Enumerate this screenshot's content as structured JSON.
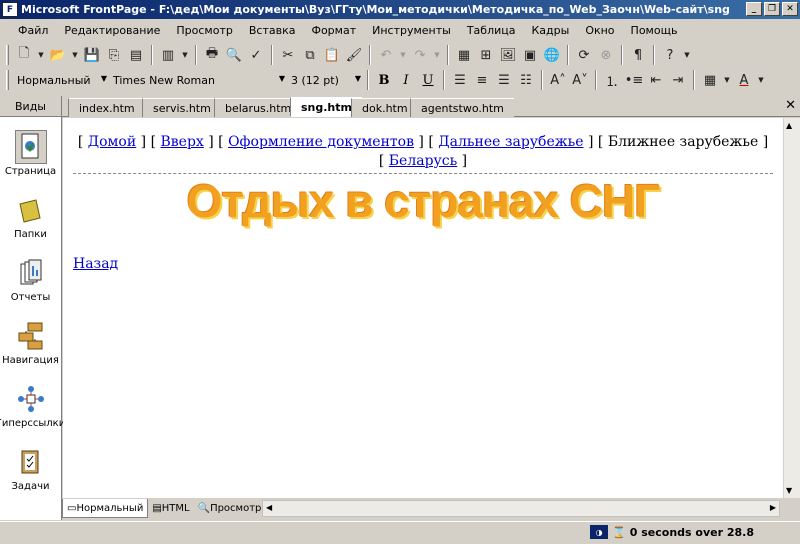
{
  "window": {
    "title": "Microsoft FrontPage - F:\\дед\\Мои документы\\Вуз\\ГГту\\Мои_методички\\Методичка_по_Web_Заочн\\Web-сайт\\sng.h..."
  },
  "menu": [
    "Файл",
    "Редактирование",
    "Просмотр",
    "Вставка",
    "Формат",
    "Инструменты",
    "Таблица",
    "Кадры",
    "Окно",
    "Помощь"
  ],
  "format_toolbar": {
    "style": "Нормальный",
    "font": "Times New Roman",
    "size": "3  (12 pt)",
    "bold": "B",
    "italic": "I",
    "underline": "U"
  },
  "views": {
    "header": "Виды",
    "items": [
      {
        "label": "Страница",
        "icon": "page-view-icon",
        "selected": true
      },
      {
        "label": "Папки",
        "icon": "folders-view-icon",
        "selected": false
      },
      {
        "label": "Отчеты",
        "icon": "reports-view-icon",
        "selected": false
      },
      {
        "label": "Навигация",
        "icon": "navigation-view-icon",
        "selected": false
      },
      {
        "label": "Гиперссылки",
        "icon": "hyperlinks-view-icon",
        "selected": false
      },
      {
        "label": "Задачи",
        "icon": "tasks-view-icon",
        "selected": false
      }
    ]
  },
  "tabs": [
    {
      "label": "index.htm",
      "active": false
    },
    {
      "label": "servis.htm",
      "active": false
    },
    {
      "label": "belarus.htm",
      "active": false
    },
    {
      "label": "sng.htm",
      "active": true
    },
    {
      "label": "dok.htm",
      "active": false
    },
    {
      "label": "agentstwo.htm",
      "active": false
    }
  ],
  "page": {
    "nav": {
      "home": "Домой",
      "up": "Вверх",
      "docs": "Оформление документов",
      "far": "Дальнее зарубежье",
      "near": "Ближнее зарубежье",
      "belarus": "Беларусь"
    },
    "heading": "Отдых в странах СНГ",
    "back": "Назад"
  },
  "modes": [
    {
      "label": "Нормальный",
      "active": true
    },
    {
      "label": "HTML",
      "active": false
    },
    {
      "label": "Просмотр",
      "active": false
    }
  ],
  "status": {
    "text": "0 seconds over 28.8"
  },
  "colors": {
    "titlebar": "#0a246a",
    "link": "#0000cc",
    "heading": "#f2a020"
  }
}
